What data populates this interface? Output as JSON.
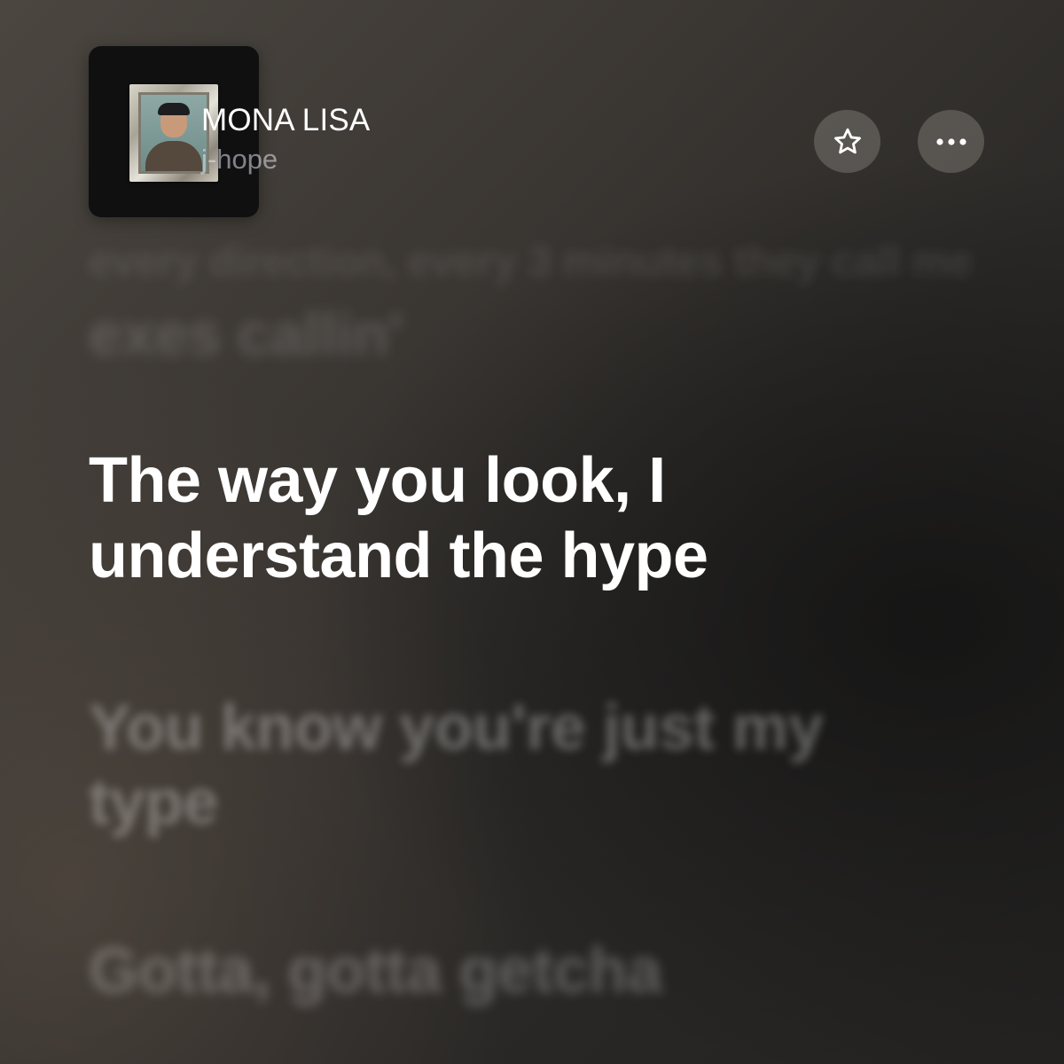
{
  "now_playing": {
    "title": "MONA LISA",
    "artist": "j-hope",
    "artwork_icon": "album-artwork"
  },
  "actions": {
    "favorite_icon": "star-outline-icon",
    "more_icon": "ellipsis-icon"
  },
  "lyrics": {
    "past": [
      "every direction, every 3 minutes they call me",
      "exes callin'"
    ],
    "current": "The way you look, I\nunderstand the hype",
    "upcoming": [
      "You know you're just my\ntype",
      "Gotta, gotta getcha"
    ]
  }
}
